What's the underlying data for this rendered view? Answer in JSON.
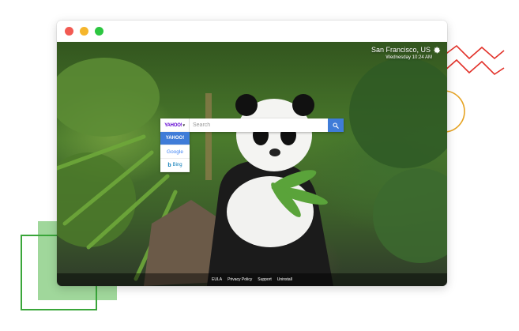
{
  "window": {
    "controls": [
      "close",
      "minimize",
      "maximize"
    ],
    "control_colors": {
      "close": "#f25a52",
      "minimize": "#f5b52c",
      "maximize": "#2cc640"
    }
  },
  "location": {
    "city": "San Francisco, US",
    "datetime": "Wednesday 10:24 AM",
    "settings_icon": "gear-icon"
  },
  "search": {
    "selected_engine": "YAHOO!",
    "placeholder": "Search",
    "value": "",
    "button_icon": "search-icon",
    "accent_color": "#3f7cd8"
  },
  "engines": [
    {
      "name": "YAHOO!",
      "active": true
    },
    {
      "name": "Google",
      "active": false
    },
    {
      "name": "Bing",
      "active": false
    }
  ],
  "footer": {
    "links": [
      "EULA",
      "Privacy Policy",
      "Support",
      "Uninstall"
    ]
  },
  "decor": {
    "zigzag_color": "#e2322a",
    "arc_color": "#e6a322",
    "square_color": "#8fd08a"
  }
}
